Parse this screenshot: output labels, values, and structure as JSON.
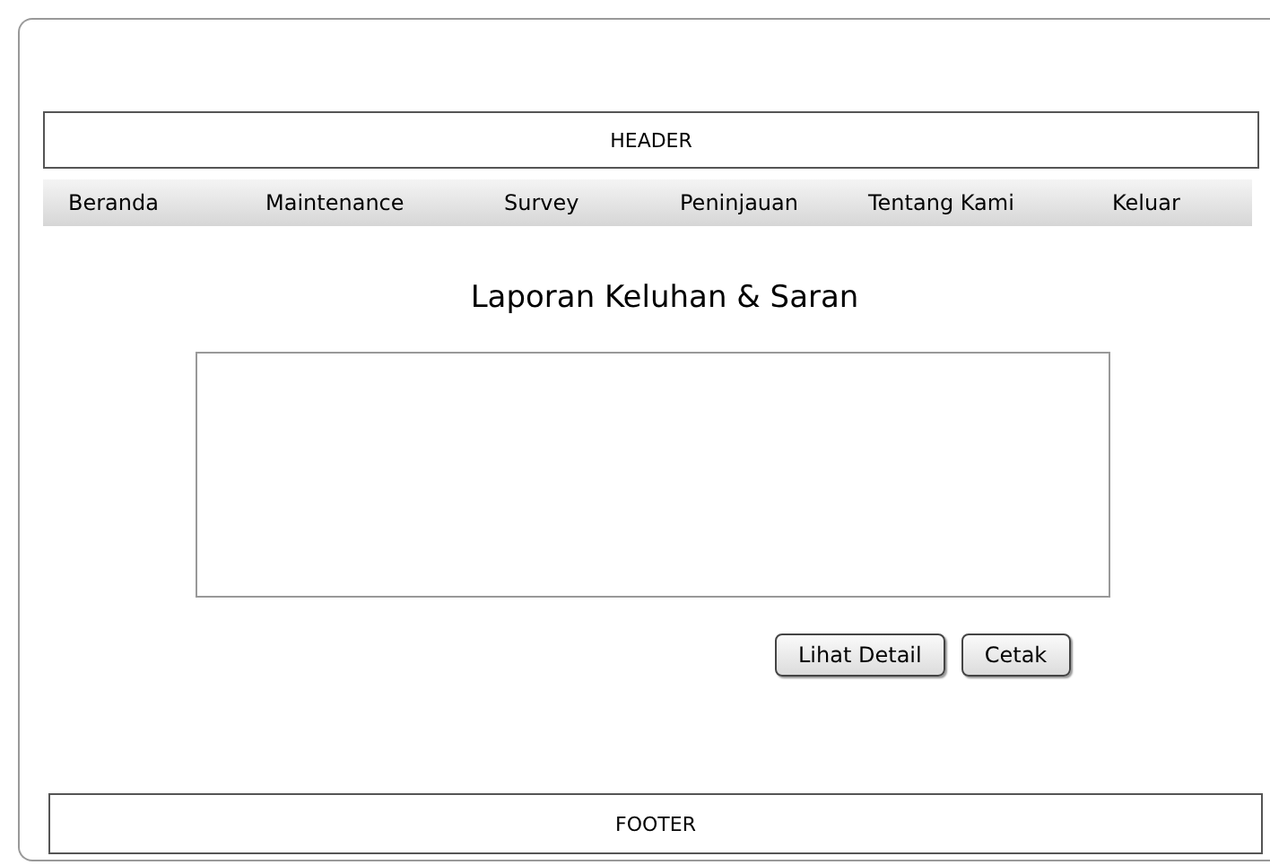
{
  "header": {
    "label": "HEADER"
  },
  "nav": [
    {
      "label": "Beranda"
    },
    {
      "label": "Maintenance"
    },
    {
      "label": "Survey"
    },
    {
      "label": "Peninjauan"
    },
    {
      "label": "Tentang Kami"
    },
    {
      "label": "Keluar"
    }
  ],
  "title": "Laporan Keluhan & Saran",
  "buttons": [
    {
      "label": "Lihat Detail"
    },
    {
      "label": "Cetak"
    }
  ],
  "footer": {
    "label": "FOOTER"
  }
}
